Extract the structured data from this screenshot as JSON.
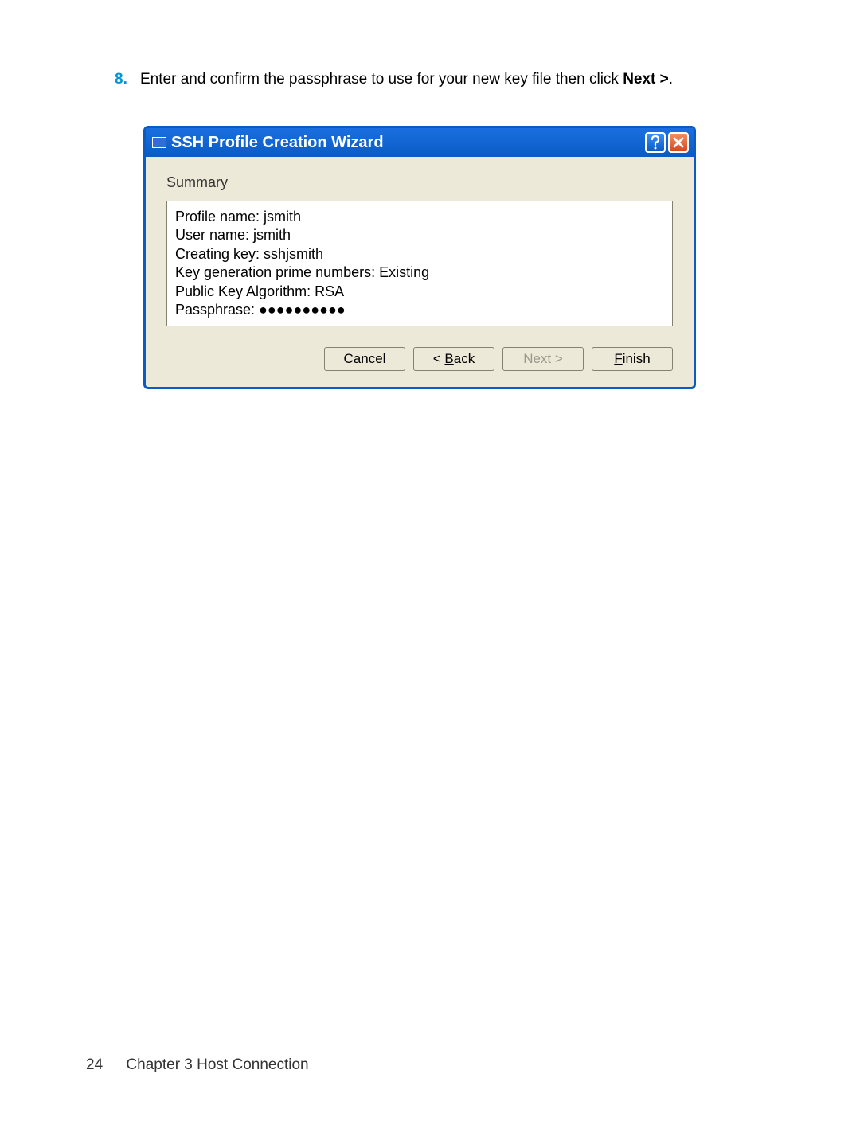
{
  "instruction": {
    "number": "8.",
    "text_before": "Enter and confirm the passphrase to use for your new key file then click ",
    "text_bold": "Next >",
    "text_after": "."
  },
  "wizard": {
    "title": "SSH Profile Creation Wizard",
    "section_label": "Summary",
    "summary_lines": [
      "Profile name: jsmith",
      "User name: jsmith",
      "Creating key: sshjsmith",
      "Key generation prime numbers: Existing",
      "Public Key Algorithm: RSA",
      "Passphrase: ●●●●●●●●●●"
    ],
    "buttons": {
      "cancel": "Cancel",
      "back_prefix": "< ",
      "back_mnemonic": "B",
      "back_suffix": "ack",
      "next": "Next >",
      "finish_mnemonic": "F",
      "finish_suffix": "inish"
    }
  },
  "footer": {
    "page": "24",
    "chapter": "Chapter 3   Host Connection"
  }
}
